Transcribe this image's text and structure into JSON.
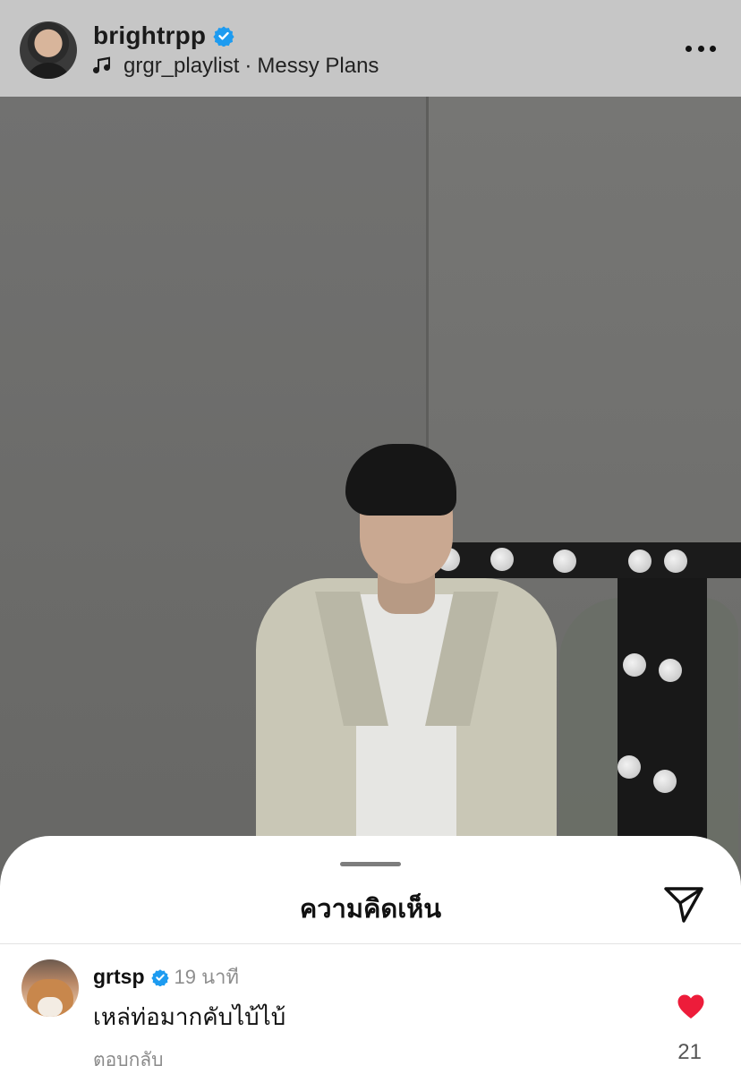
{
  "post": {
    "username": "brightrpp",
    "music_user": "grgr_playlist",
    "music_separator": "·",
    "music_title": "Messy Plans"
  },
  "comments_sheet": {
    "title": "ความคิดเห็น"
  },
  "comment": {
    "username": "grtsp",
    "time": "19 นาที",
    "text": "เหล่ท่อมากคับไบ้ไบ้",
    "reply_label": "ตอบกลับ",
    "like_count": "21"
  },
  "colors": {
    "verified": "#1d9bf0",
    "liked_heart": "#ed1c3a",
    "header_bg": "#c6c6c6"
  },
  "icons": {
    "verified": "verified-badge-icon",
    "music": "music-note-icon",
    "more": "more-options-icon",
    "share": "send-paper-plane-icon",
    "like": "heart-filled-icon"
  }
}
